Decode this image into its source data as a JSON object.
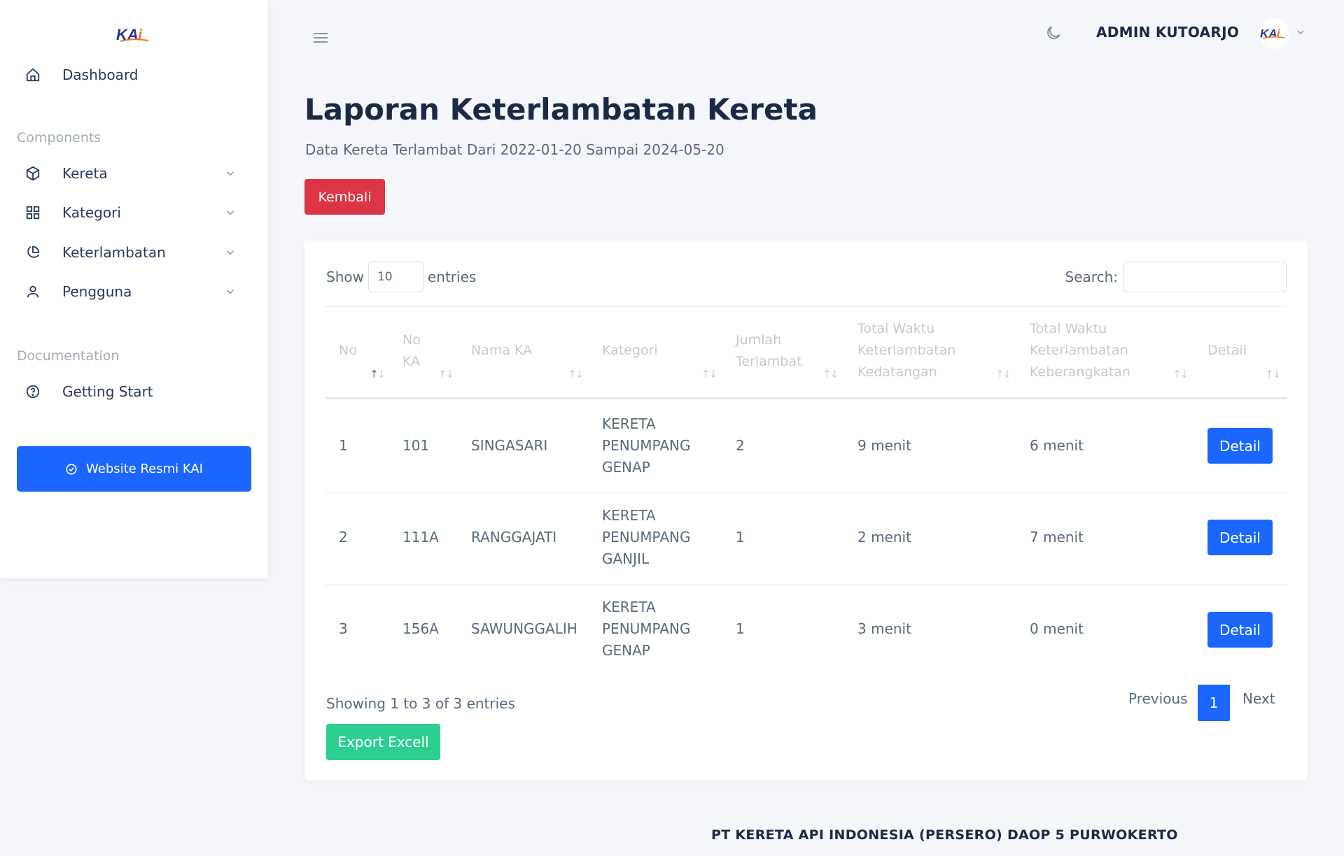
{
  "app": {
    "logo_text": "KAi"
  },
  "sidebar": {
    "dashboard": "Dashboard",
    "components_heading": "Components",
    "items": [
      {
        "label": "Kereta",
        "icon": "cube-icon"
      },
      {
        "label": "Kategori",
        "icon": "grid-icon"
      },
      {
        "label": "Keterlambatan",
        "icon": "pie-chart-icon"
      },
      {
        "label": "Pengguna",
        "icon": "user-icon"
      }
    ],
    "documentation_heading": "Documentation",
    "getting_start": "Getting Start",
    "website_button": "Website Resmi KAI"
  },
  "topbar": {
    "user_name": "ADMIN KUTOARJO"
  },
  "header": {
    "title": "Laporan Keterlambatan Kereta",
    "subtitle": "Data Kereta Terlambat Dari 2022-01-20 Sampai 2024-05-20",
    "back_button": "Kembali"
  },
  "table_controls": {
    "show_label": "Show",
    "entries_value": "10",
    "entries_label": "entries",
    "search_label": "Search:"
  },
  "table": {
    "columns": [
      [
        "No"
      ],
      [
        "No",
        "KA"
      ],
      [
        "Nama KA"
      ],
      [
        "Kategori"
      ],
      [
        "Jumlah",
        "Terlambat"
      ],
      [
        "Total Waktu",
        "Keterlambatan",
        "Kedatangan"
      ],
      [
        "Total Waktu",
        "Keterlambatan",
        "Keberangkatan"
      ],
      [
        "Detail"
      ]
    ],
    "rows": [
      {
        "no": "1",
        "no_ka": "101",
        "nama": "SINGASARI",
        "kategori": [
          "KERETA",
          "PENUMPANG",
          "GENAP"
        ],
        "jumlah": "2",
        "kedatangan": "9 menit",
        "keberangkatan": "6 menit",
        "detail": "Detail"
      },
      {
        "no": "2",
        "no_ka": "111A",
        "nama": "RANGGAJATI",
        "kategori": [
          "KERETA",
          "PENUMPANG",
          "GANJIL"
        ],
        "jumlah": "1",
        "kedatangan": "2 menit",
        "keberangkatan": "7 menit",
        "detail": "Detail"
      },
      {
        "no": "3",
        "no_ka": "156A",
        "nama": "SAWUNGGALIH",
        "kategori": [
          "KERETA",
          "PENUMPANG",
          "GENAP"
        ],
        "jumlah": "1",
        "kedatangan": "3 menit",
        "keberangkatan": "0 menit",
        "detail": "Detail"
      }
    ]
  },
  "table_footer": {
    "info": "Showing 1 to 3 of 3 entries",
    "export_button": "Export Excell",
    "previous": "Previous",
    "current_page": "1",
    "next": "Next"
  },
  "footer": {
    "text": "PT KERETA API INDONESIA (PERSERO) DAOP 5 PURWOKERTO"
  },
  "colors": {
    "primary": "#1a66ff",
    "danger": "#dc3545",
    "success": "#2ccf8f",
    "heading": "#1b2945",
    "logo_blue": "#2a3a8c",
    "logo_orange": "#f37021"
  }
}
